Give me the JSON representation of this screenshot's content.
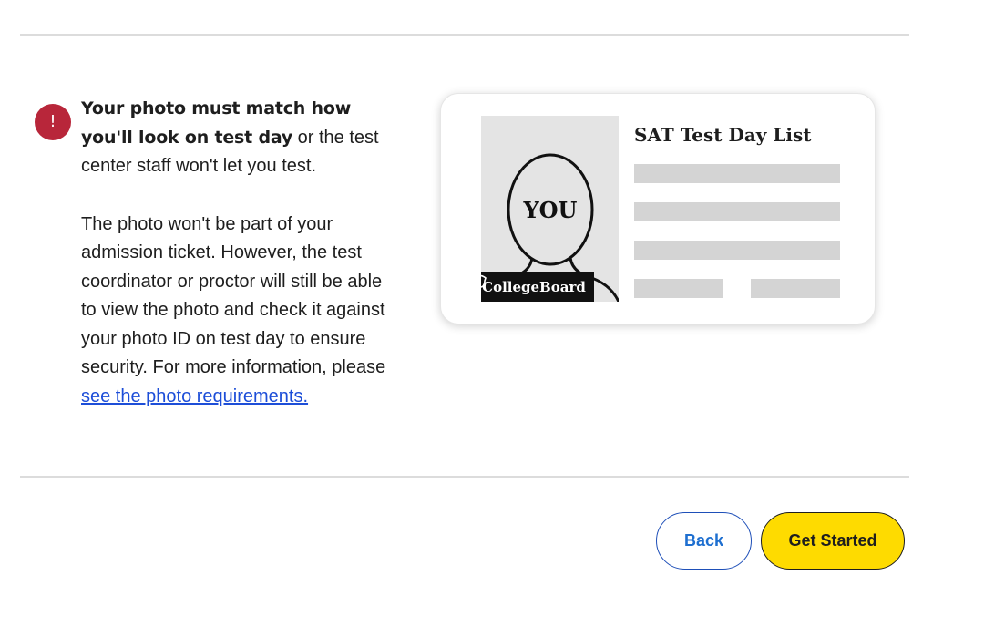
{
  "alert": {
    "icon": "exclamation-icon",
    "glyph": "!",
    "color": "#b8263a"
  },
  "notice": {
    "bold_text": "Your photo must match how you'll look on test day",
    "rest_text": " or the test center staff won't let you test.",
    "info_text": "The photo won't be part of your admission ticket. However, the test coordinator or proctor will still be able to view the photo and check it against your photo ID on test day to ensure security. For more information, please ",
    "link_text": "see the photo requirements."
  },
  "card": {
    "photo_label": "YOU",
    "badge_text": "CollegeBoard",
    "badge_icon": "acorn-icon",
    "title": "SAT Test Day List"
  },
  "buttons": {
    "back_label": "Back",
    "start_label": "Get Started"
  },
  "colors": {
    "accent_yellow": "#fedb00",
    "link_blue": "#1d4ed8",
    "alert_red": "#b8263a",
    "back_text": "#1e6fd0"
  }
}
